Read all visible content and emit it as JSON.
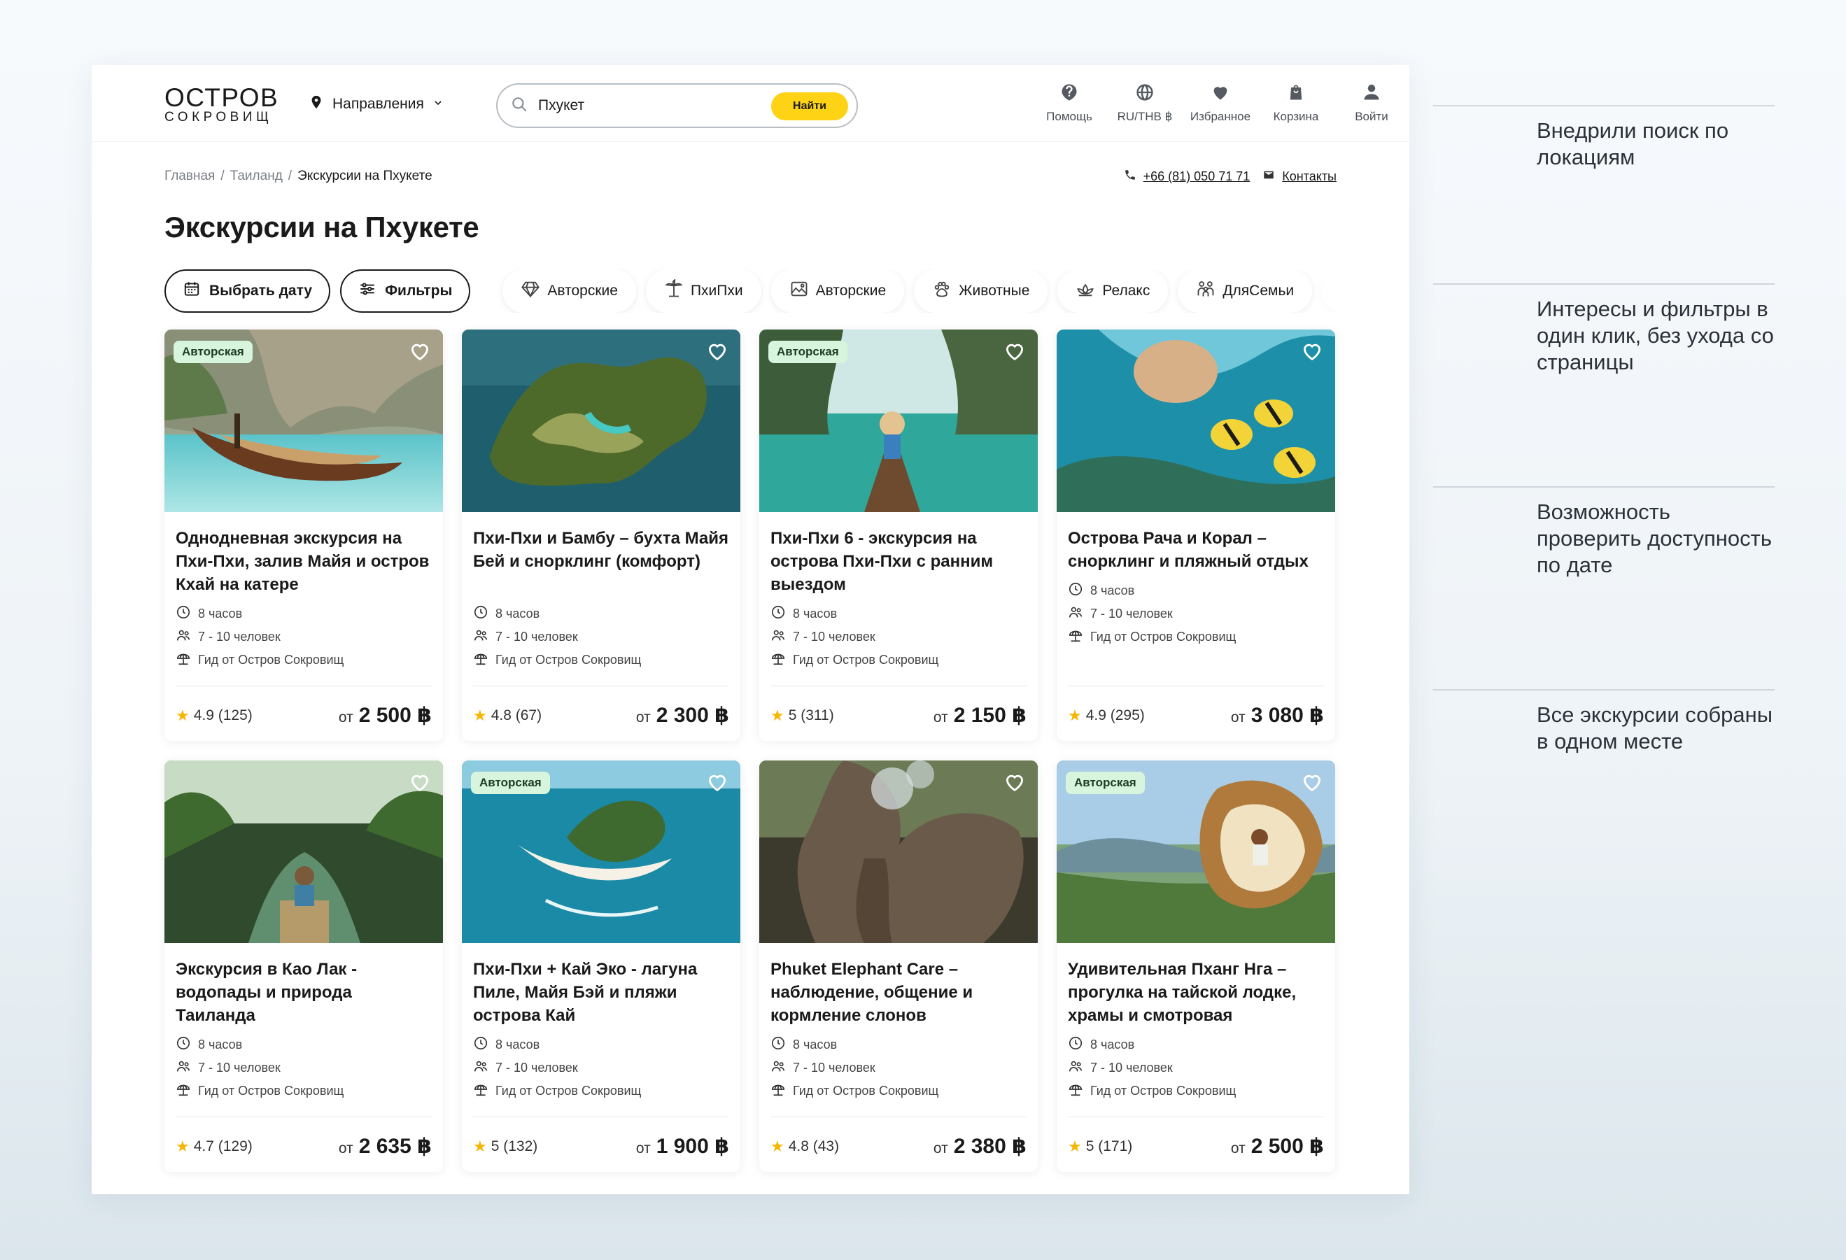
{
  "header": {
    "logo_top": "ОСТРОВ",
    "logo_bottom": "СОКРОВИЩ",
    "directions_label": "Направления",
    "search_value": "Пхукет",
    "search_button": "Найти",
    "actions": [
      {
        "label": "Помощь",
        "icon": "help-icon"
      },
      {
        "label": "RU/THB ฿",
        "icon": "globe-icon"
      },
      {
        "label": "Избранное",
        "icon": "heart-icon"
      },
      {
        "label": "Корзина",
        "icon": "bag-icon"
      },
      {
        "label": "Войти",
        "icon": "user-icon"
      }
    ]
  },
  "breadcrumb": [
    "Главная",
    "/",
    "Таиланд",
    "/",
    "Экскурсии на Пхукете"
  ],
  "contacts": {
    "phone": "+66 (81) 050 71 71",
    "link": "Контакты"
  },
  "page_title": "Экскурсии на Пхукете",
  "filters": {
    "date_button": "Выбрать дату",
    "filters_button": "Фильтры",
    "chips": [
      "Авторские",
      "ПхиПхи",
      "Авторские",
      "Животные",
      "Релакс",
      "ДляСемьи"
    ]
  },
  "cards": [
    {
      "badge": "Авторская",
      "title": "Однодневная экскурсия на Пхи-Пхи, залив Майя и остров Кхай на катере",
      "duration": "8 часов",
      "group": "7 - 10 человек",
      "guide": "Гид от Остров Сокровищ",
      "rating": "4.9 (125)",
      "price_prefix": "от",
      "price": "2 500 ฿"
    },
    {
      "badge": "",
      "title": "Пхи-Пхи и Бамбу – бухта Майя Бей и снорклинг (комфорт)",
      "duration": "8 часов",
      "group": "7 - 10 человек",
      "guide": "Гид от Остров Сокровищ",
      "rating": "4.8 (67)",
      "price_prefix": "от",
      "price": "2 300 ฿"
    },
    {
      "badge": "Авторская",
      "title": "Пхи-Пхи 6 - экскурсия на острова Пхи-Пхи с ранним выездом",
      "duration": "8 часов",
      "group": "7 - 10 человек",
      "guide": "Гид от Остров Сокровищ",
      "rating": "5 (311)",
      "price_prefix": "от",
      "price": "2 150 ฿"
    },
    {
      "badge": "",
      "title": "Острова Рача и Корал – снорклинг и пляжный отдых",
      "duration": "8 часов",
      "group": "7 - 10 человек",
      "guide": "Гид от Остров Сокровищ",
      "rating": "4.9 (295)",
      "price_prefix": "от",
      "price": "3 080 ฿"
    },
    {
      "badge": "",
      "title": "Экскурсия в Као Лак - водопады и природа Таиланда",
      "duration": "8 часов",
      "group": "7 - 10 человек",
      "guide": "Гид от Остров Сокровищ",
      "rating": "4.7 (129)",
      "price_prefix": "от",
      "price": "2 635 ฿"
    },
    {
      "badge": "Авторская",
      "title": "Пхи-Пхи + Кай Эко - лагуна Пиле, Майя Бэй и пляжи острова Кай",
      "duration": "8 часов",
      "group": "7 - 10 человек",
      "guide": "Гид от Остров Сокровищ",
      "rating": "5 (132)",
      "price_prefix": "от",
      "price": "1 900 ฿"
    },
    {
      "badge": "",
      "title": "Phuket Elephant Care – наблюдение, общение и кормление слонов",
      "duration": "8 часов",
      "group": "7 - 10 человек",
      "guide": "Гид от Остров Сокровищ",
      "rating": "4.8 (43)",
      "price_prefix": "от",
      "price": "2 380 ฿"
    },
    {
      "badge": "Авторская",
      "title": "Удивительная Пханг Нга – прогулка на тайской лодке, храмы и смотровая",
      "duration": "8 часов",
      "group": "7 - 10 человек",
      "guide": "Гид от Остров Сокровищ",
      "rating": "5 (171)",
      "price_prefix": "от",
      "price": "2 500 ฿"
    }
  ],
  "notes": [
    "Внедрили поиск по локациям",
    "Интересы и фильтры в один клик, без ухода со страницы",
    "Возможность проверить доступность по дате",
    "Все экскурсии собраны в одном месте"
  ],
  "colors": {
    "accent": "#ffd315",
    "badge_bg": "#d6f5dc",
    "star": "#f6b500"
  }
}
